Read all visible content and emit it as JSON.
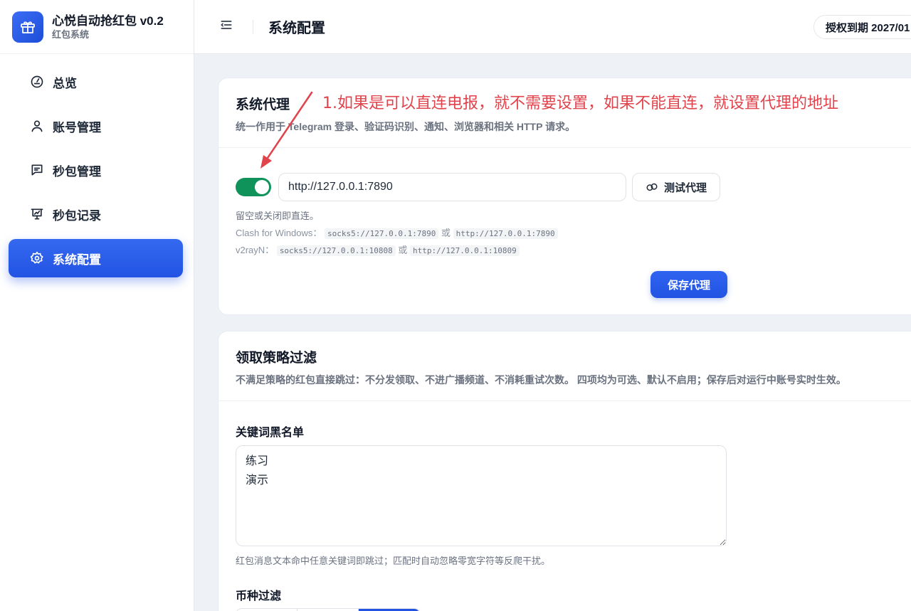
{
  "app": {
    "title": "心悦自动抢红包 v0.2",
    "subtitle": "红包系统"
  },
  "sidebar": {
    "items": [
      {
        "label": "总览",
        "icon": "dashboard-gauge-icon"
      },
      {
        "label": "账号管理",
        "icon": "user-icon"
      },
      {
        "label": "秒包管理",
        "icon": "message-icon"
      },
      {
        "label": "秒包记录",
        "icon": "chart-board-icon"
      },
      {
        "label": "系统配置",
        "icon": "gear-icon",
        "active": true
      }
    ]
  },
  "header": {
    "title": "系统配置",
    "license": "授权到期 2027/01"
  },
  "proxy": {
    "title": "系统代理",
    "desc": "统一作用于 Telegram 登录、验证码识别、通知、浏览器和相关 HTTP 请求。",
    "enabled": true,
    "value": "http://127.0.0.1:7890",
    "test_label": "测试代理",
    "hint_main": "留空或关闭即直连。",
    "hint_clash_prefix": "Clash for Windows：",
    "hint_clash_a": "socks5://127.0.0.1:7890",
    "hint_or": "或",
    "hint_clash_b": "http://127.0.0.1:7890",
    "hint_v2_prefix": "v2rayN：",
    "hint_v2_a": "socks5://127.0.0.1:10808",
    "hint_v2_b": "http://127.0.0.1:10809",
    "save_label": "保存代理"
  },
  "annotation": {
    "text": "1.如果是可以直连电报，就不需要设置，如果不能直连，就设置代理的地址",
    "color": "#e0434b"
  },
  "strategy": {
    "title": "领取策略过滤",
    "desc": "不满足策略的红包直接跳过：不分发领取、不进广播频道、不消耗重试次数。 四项均为可选、默认不启用；保存后对运行中账号实时生效。",
    "blacklist_label": "关键词黑名单",
    "blacklist_value": "练习\n演示",
    "blacklist_hint": "红包消息文本命中任意关键词即跳过；匹配时自动忽略零宽字符等反爬干扰。",
    "currency_label": "币种过滤"
  },
  "colors": {
    "accent": "#2253e3",
    "toggle_on": "#10935b",
    "annotation": "#e0434b"
  }
}
